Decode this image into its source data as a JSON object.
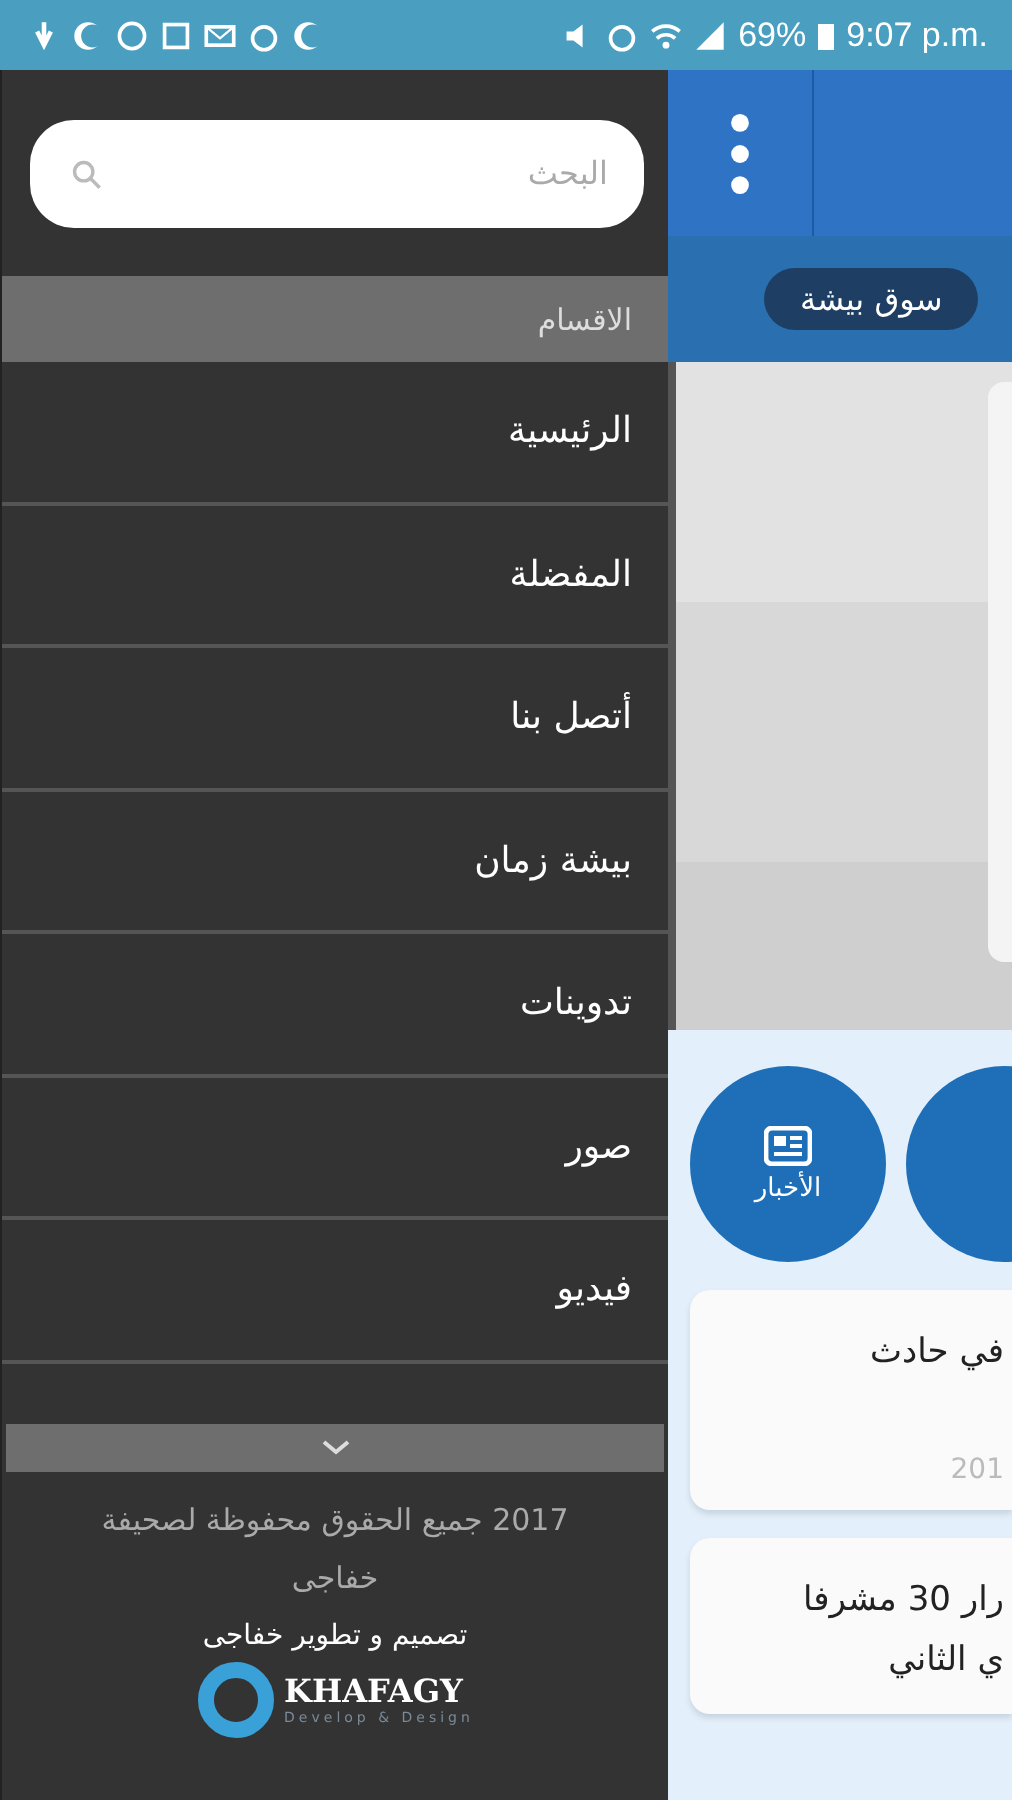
{
  "status_bar": {
    "battery": "69%",
    "time": "9:07 p.m."
  },
  "drawer": {
    "search": {
      "placeholder": "البحث"
    },
    "section_header": "الاقسام",
    "items": [
      {
        "label": "الرئيسية"
      },
      {
        "label": "المفضلة"
      },
      {
        "label": "أتصل بنا"
      },
      {
        "label": "بيشة زمان"
      },
      {
        "label": "تدوينات"
      },
      {
        "label": "صور"
      },
      {
        "label": "فيديو"
      }
    ],
    "footer": {
      "copyright": "2017 جميع الحقوق محفوظة لصحيفة خفاجى",
      "credit": "تصميم و تطوير خفاجى",
      "logo_name": "KHAFAGY",
      "logo_tagline": "Develop & Design"
    }
  },
  "main": {
    "chip": "سوق بيشة",
    "shortcut": {
      "label": "الأخبار"
    },
    "cards": [
      {
        "lines": [
          "في حادث"
        ],
        "date": "201"
      },
      {
        "lines": [
          "رار 30 مشرفا",
          "ي الثاني"
        ]
      }
    ]
  }
}
